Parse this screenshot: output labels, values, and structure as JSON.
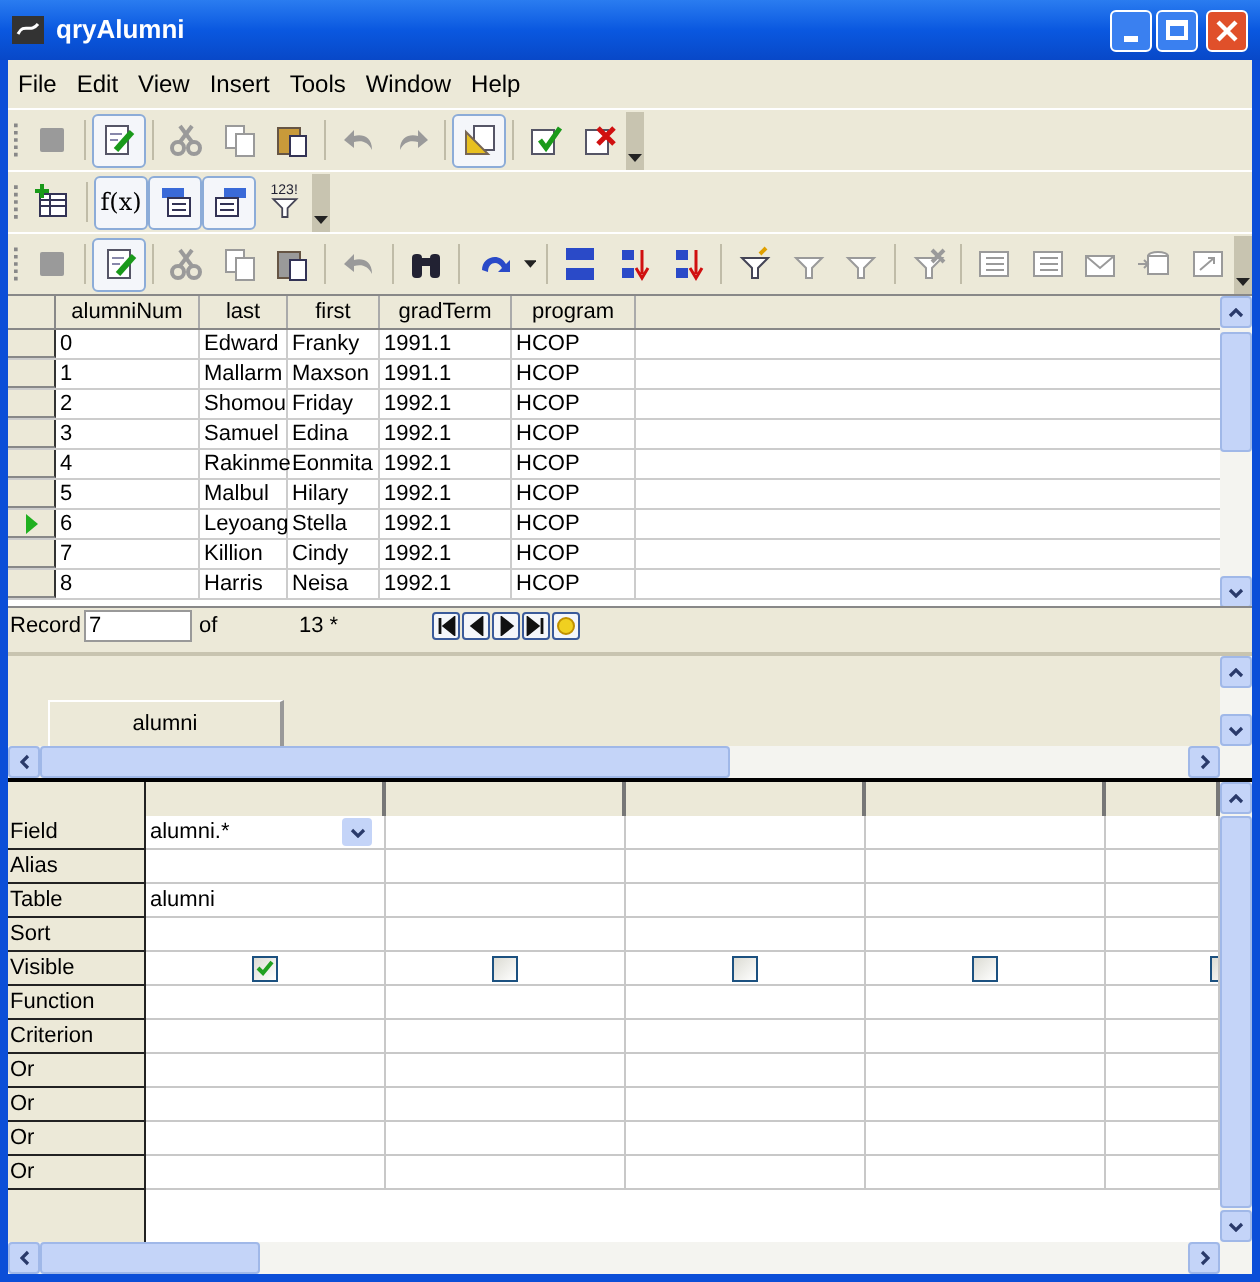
{
  "window": {
    "title": "qryAlumni"
  },
  "menu": [
    "File",
    "Edit",
    "View",
    "Insert",
    "Tools",
    "Window",
    "Help"
  ],
  "toolbars": [
    {
      "items": [
        {
          "kind": "button",
          "pressed": false,
          "disabled": true
        },
        {
          "kind": "separator"
        },
        {
          "kind": "button",
          "pressed": true,
          "disabled": false
        },
        {
          "kind": "separator"
        },
        {
          "kind": "button",
          "pressed": false,
          "disabled": true
        },
        {
          "kind": "button",
          "pressed": false,
          "disabled": true
        },
        {
          "kind": "button",
          "pressed": false,
          "disabled": false
        },
        {
          "kind": "separator"
        },
        {
          "kind": "button",
          "pressed": false,
          "disabled": true
        },
        {
          "kind": "button",
          "pressed": false,
          "disabled": true
        },
        {
          "kind": "separator"
        },
        {
          "kind": "button",
          "pressed": true,
          "disabled": false
        },
        {
          "kind": "separator"
        },
        {
          "kind": "button",
          "pressed": false,
          "disabled": false
        },
        {
          "kind": "button",
          "pressed": false,
          "disabled": false
        }
      ]
    },
    {
      "items": [
        {
          "kind": "button",
          "pressed": false,
          "disabled": false
        },
        {
          "kind": "separator"
        },
        {
          "kind": "button",
          "pressed": true,
          "disabled": false,
          "label": "f(x)"
        },
        {
          "kind": "button",
          "pressed": true,
          "disabled": false
        },
        {
          "kind": "button",
          "pressed": true,
          "disabled": false
        },
        {
          "kind": "button",
          "pressed": false,
          "disabled": false,
          "label": "123!"
        }
      ]
    },
    {
      "items": [
        {
          "kind": "button",
          "pressed": false,
          "disabled": true
        },
        {
          "kind": "separator"
        },
        {
          "kind": "button",
          "pressed": true,
          "disabled": false
        },
        {
          "kind": "separator"
        },
        {
          "kind": "button",
          "pressed": false,
          "disabled": true
        },
        {
          "kind": "button",
          "pressed": false,
          "disabled": true
        },
        {
          "kind": "button",
          "pressed": false,
          "disabled": true
        },
        {
          "kind": "separator"
        },
        {
          "kind": "button",
          "pressed": false,
          "disabled": true
        },
        {
          "kind": "separator"
        },
        {
          "kind": "button",
          "pressed": false,
          "disabled": false
        },
        {
          "kind": "separator"
        },
        {
          "kind": "button",
          "pressed": false,
          "disabled": false
        },
        {
          "kind": "separator"
        },
        {
          "kind": "button",
          "pressed": false,
          "disabled": false
        },
        {
          "kind": "button",
          "pressed": false,
          "disabled": false
        },
        {
          "kind": "button",
          "pressed": false,
          "disabled": false
        },
        {
          "kind": "separator"
        },
        {
          "kind": "button",
          "pressed": false,
          "disabled": false
        },
        {
          "kind": "button",
          "pressed": false,
          "disabled": true
        },
        {
          "kind": "button",
          "pressed": false,
          "disabled": true
        },
        {
          "kind": "separator"
        },
        {
          "kind": "button",
          "pressed": false,
          "disabled": true
        },
        {
          "kind": "separator"
        },
        {
          "kind": "button",
          "pressed": false,
          "disabled": true
        },
        {
          "kind": "button",
          "pressed": false,
          "disabled": true
        },
        {
          "kind": "button",
          "pressed": false,
          "disabled": true
        },
        {
          "kind": "button",
          "pressed": false,
          "disabled": true
        },
        {
          "kind": "button",
          "pressed": false,
          "disabled": true
        }
      ]
    }
  ],
  "results": {
    "columns": [
      "alumniNum",
      "last",
      "first",
      "gradTerm",
      "program"
    ],
    "rows": [
      {
        "current": false,
        "cells": [
          "0",
          "Edward",
          "Franky",
          "1991.1",
          "HCOP"
        ]
      },
      {
        "current": false,
        "cells": [
          "1",
          "Mallarm",
          "Maxson",
          "1991.1",
          "HCOP"
        ]
      },
      {
        "current": false,
        "cells": [
          "2",
          "Shomou",
          "Friday",
          "1992.1",
          "HCOP"
        ]
      },
      {
        "current": false,
        "cells": [
          "3",
          "Samuel",
          "Edina",
          "1992.1",
          "HCOP"
        ]
      },
      {
        "current": false,
        "cells": [
          "4",
          "Rakinme",
          "Eonmita",
          "1992.1",
          "HCOP"
        ]
      },
      {
        "current": false,
        "cells": [
          "5",
          "Malbul",
          "Hilary",
          "1992.1",
          "HCOP"
        ]
      },
      {
        "current": true,
        "cells": [
          "6",
          "Leyoang",
          "Stella",
          "1992.1",
          "HCOP"
        ]
      },
      {
        "current": false,
        "cells": [
          "7",
          "Killion",
          "Cindy",
          "1992.1",
          "HCOP"
        ]
      },
      {
        "current": false,
        "cells": [
          "8",
          "Harris",
          "Neisa",
          "1992.1",
          "HCOP"
        ]
      }
    ],
    "record_bar": {
      "label": "Record",
      "value": "7",
      "of": "of",
      "count": "13 *"
    }
  },
  "tables": [
    {
      "name": "alumni"
    }
  ],
  "design": {
    "row_labels": [
      "Field",
      "Alias",
      "Table",
      "Sort",
      "Visible",
      "Function",
      "Criterion",
      "Or",
      "Or",
      "Or",
      "Or"
    ],
    "columns": [
      {
        "field": "alumni.*",
        "table": "alumni",
        "visible": true,
        "focused": true
      },
      {
        "visible": false,
        "focused": false
      },
      {
        "visible": false,
        "focused": false
      },
      {
        "visible": false,
        "focused": false
      },
      {
        "visible": false,
        "focused": false
      }
    ]
  }
}
